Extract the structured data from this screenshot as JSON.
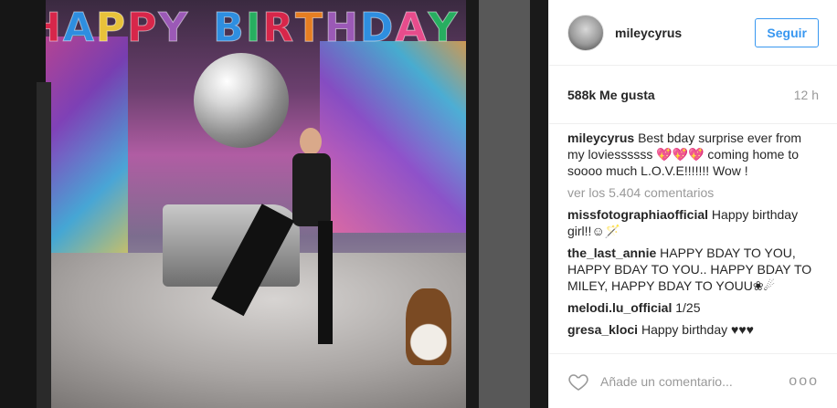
{
  "photo": {
    "alt_label": "",
    "banner_letters": [
      "H",
      "A",
      "P",
      "P",
      "Y",
      "B",
      "I",
      "R",
      "T",
      "H",
      "D",
      "A",
      "Y"
    ],
    "banner_colors": [
      "#d7264a",
      "#2e8ee0",
      "#e8c23a",
      "#d7264a",
      "#9b59b6",
      "#2e8ee0",
      "#27ae60",
      "#d7264a",
      "#e67e22",
      "#9b59b6",
      "#2e8ee0",
      "#e74c8c",
      "#27ae60"
    ]
  },
  "header": {
    "username": "mileycyrus",
    "follow_label": "Seguir"
  },
  "stats": {
    "likes": "588k Me gusta",
    "time": "12 h"
  },
  "caption": {
    "user": "mileycyrus",
    "text": "Best bday surprise ever from my loviessssss 💖💖💖 coming home to soooo much L.O.V.E!!!!!!! Wow !"
  },
  "view_all": "ver los 5.404 comentarios",
  "comments": [
    {
      "user": "missfotographiaofficial",
      "text": "Happy birthday girl!!☺🪄"
    },
    {
      "user": "the_last_annie",
      "text": "HAPPY BDAY TO YOU, HAPPY BDAY TO YOU.. HAPPY BDAY TO MILEY, HAPPY BDAY TO YOUU❀☄"
    },
    {
      "user": "melodi.lu_official",
      "text": "1/25"
    },
    {
      "user": "gresa_kloci",
      "text": "Happy birthday ♥♥♥"
    },
    {
      "user": "",
      "text": ""
    }
  ],
  "footer": {
    "comment_placeholder": "Añade un comentario...",
    "more_label": "ooo"
  },
  "icons": {
    "heart": "heart-outline-icon",
    "more": "more-options-icon"
  },
  "colors": {
    "accent": "#3897f0",
    "muted": "#999999",
    "text": "#262626"
  }
}
